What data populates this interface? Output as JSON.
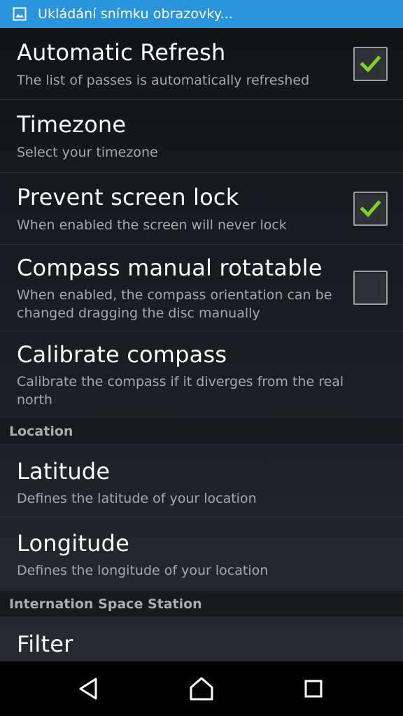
{
  "status_bar": {
    "icon": "image-icon",
    "text": "Ukládání snímku obrazovky..."
  },
  "preferences": [
    {
      "title": "Automatic Refresh",
      "summary": "The list of passes is automatically refreshed",
      "checkbox": true,
      "checked": true
    },
    {
      "title": "Timezone",
      "summary": "Select your timezone",
      "checkbox": false
    },
    {
      "title": "Prevent screen lock",
      "summary": "When enabled the screen will never lock",
      "checkbox": true,
      "checked": true
    },
    {
      "title": "Compass manual rotatable",
      "summary": "When enabled, the compass orientation can be changed dragging the disc manually",
      "checkbox": true,
      "checked": false
    },
    {
      "title": "Calibrate compass",
      "summary": "Calibrate the compass if it diverges from the real north",
      "checkbox": false
    }
  ],
  "location_group": {
    "header": "Location",
    "items": [
      {
        "title": "Latitude",
        "summary": "Defines the latitude of your location"
      },
      {
        "title": "Longitude",
        "summary": "Defines the longitude of your location"
      }
    ]
  },
  "iss_group": {
    "header": "Internation Space Station",
    "items": [
      {
        "title": "Filter"
      }
    ]
  },
  "nav_bar": {
    "back_icon": "back-icon",
    "home_icon": "home-icon",
    "recents_icon": "recents-icon"
  },
  "colors": {
    "status_bar": "#2a95dc",
    "check_mark": "#7ed321",
    "title_text": "#ffffff",
    "summary_text": "#a5a9ad"
  }
}
